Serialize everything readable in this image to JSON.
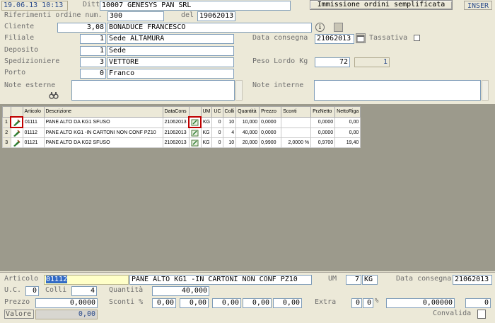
{
  "header": {
    "datetime": "19.06.13 10:13",
    "ditta_label": "Ditta",
    "ditta_code": "10007",
    "ditta_name": "GENESYS PAN SRL",
    "quick_entry_label": "Immissione ordini semplificata",
    "mode": "INSER"
  },
  "form": {
    "rif_label": "Riferimenti ordine num.",
    "rif_num": "300",
    "del_label": "del",
    "del_date": "19062013",
    "cliente_label": "Cliente",
    "cliente_code": "3,08",
    "cliente_name": "BONADUCE FRANCESCO",
    "filiale_label": "Filiale",
    "filiale_code": "1",
    "filiale_name": "Sede ALTAMURA",
    "deposito_label": "Deposito",
    "deposito_code": "1",
    "deposito_name": "Sede",
    "sped_label": "Spedizioniere",
    "sped_code": "3",
    "sped_name": "VETTORE",
    "porto_label": "Porto",
    "porto_code": "0",
    "porto_name": "Franco",
    "note_esterne_label": "Note esterne",
    "note_esterne": "",
    "data_consegna_label": "Data consegna",
    "data_consegna": "21062013",
    "tassativa_label": "Tassativa",
    "peso_label": "Peso Lordo Kg",
    "peso": "72",
    "peso_colli": "1",
    "note_interne_label": "Note interne",
    "note_interne": ""
  },
  "grid": {
    "columns": [
      "Articolo",
      "Descrizione",
      "DataCons",
      "UM",
      "UC",
      "Colli",
      "Quantità",
      "Prezzo",
      "Sconti",
      "PrzNetto",
      "NettoRiga"
    ],
    "rows": [
      {
        "n": "1",
        "articolo": "01111",
        "descrizione": "PANE ALTO DA KG1 SFUSO",
        "datacons": "21062013",
        "um": "KG",
        "uc": "0",
        "colli": "10",
        "quantita": "10,000",
        "prezzo": "0,0000",
        "sconti": "",
        "prznetto": "0,0000",
        "nettoriga": "0,00"
      },
      {
        "n": "2",
        "articolo": "01112",
        "descrizione": "PANE ALTO KG1 -IN CARTONI NON CONF PZ10",
        "datacons": "21062013",
        "um": "KG",
        "uc": "0",
        "colli": "4",
        "quantita": "40,000",
        "prezzo": "0,0000",
        "sconti": "",
        "prznetto": "0,0000",
        "nettoriga": "0,00"
      },
      {
        "n": "3",
        "articolo": "01121",
        "descrizione": "PANE ALTO DA KG2 SFUSO",
        "datacons": "21062013",
        "um": "KG",
        "uc": "0",
        "colli": "10",
        "quantita": "20,000",
        "prezzo": "0,9900",
        "sconti": "2,0000 %",
        "prznetto": "0,9700",
        "nettoriga": "19,40"
      }
    ]
  },
  "detail": {
    "articolo_label": "Articolo",
    "articolo_code": "01112",
    "articolo_desc": "PANE ALTO KG1 -IN CARTONI NON CONF PZ10",
    "um_label": "UM",
    "um_code": "7",
    "um_value": "KG",
    "data_consegna_label": "Data consegna",
    "data_consegna": "21062013",
    "uc_label": "U.C.",
    "uc": "0",
    "colli_label": "Colli",
    "colli": "4",
    "quantita_label": "Quantità",
    "quantita": "40,000",
    "prezzo_label": "Prezzo",
    "prezzo": "0,0000",
    "sconti_label": "Sconti %",
    "sconti": [
      "0,00",
      "0,00",
      "0,00",
      "0,00",
      "0,00"
    ],
    "extra_label": "Extra",
    "extra_a": "0",
    "extra_b": "0",
    "extra_pct": "%",
    "extra_value": "0,00000",
    "extra_last": "0",
    "valore_label": "Valore",
    "valore": "0,00",
    "convalida_label": "Convalida"
  }
}
